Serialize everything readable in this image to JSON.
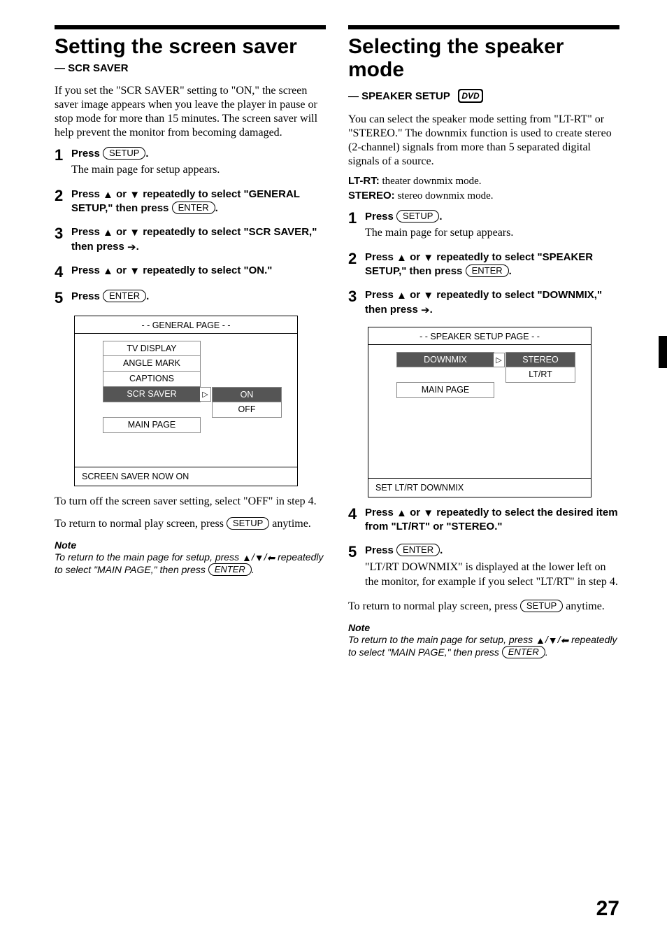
{
  "page_number": "27",
  "left": {
    "title": "Setting the screen saver",
    "subtitle": "— SCR SAVER",
    "intro": "If you set the \"SCR SAVER\" setting to \"ON,\" the screen saver image appears when you leave the player in pause or stop mode for more than 15 minutes. The screen saver will help prevent the monitor from becoming damaged.",
    "steps": {
      "s1a": "Press ",
      "s1btn": "SETUP",
      "s1b": ".",
      "s1sub": "The main page for setup appears.",
      "s2a": "Press ",
      "s2b": " or ",
      "s2c": " repeatedly to select \"GENERAL SETUP,\" then press ",
      "s2btn": "ENTER",
      "s2d": ".",
      "s3a": "Press ",
      "s3b": " or ",
      "s3c": " repeatedly to select \"SCR SAVER,\" then press ",
      "s3d": ".",
      "s4a": "Press ",
      "s4b": " or ",
      "s4c": " repeatedly to select \"ON.\"",
      "s5a": "Press ",
      "s5btn": "ENTER",
      "s5b": "."
    },
    "osd": {
      "title": "- - GENERAL PAGE - -",
      "items": [
        "TV  DISPLAY",
        "ANGLE MARK",
        "CAPTIONS",
        "SCR SAVER",
        "MAIN PAGE"
      ],
      "options": [
        "ON",
        "OFF"
      ],
      "footer": "SCREEN SAVER NOW ON"
    },
    "after1": "To turn off the screen saver setting, select \"OFF\" in step 4.",
    "after2a": "To return to normal play screen, press ",
    "after2btn": "SETUP",
    "after2b": " anytime.",
    "note_h": "Note",
    "note_a": "To return to the main page for setup, press ",
    "note_b": " repeatedly to select \"MAIN PAGE,\" then press ",
    "note_btn": "ENTER",
    "note_c": "."
  },
  "right": {
    "title_a": "Selecting the speaker mode",
    "subtitle": " — SPEAKER SETUP",
    "intro": "You can select the speaker mode setting from \"LT-RT\" or \"STEREO.\" The downmix function is used to create stereo (2-channel) signals from more than 5 separated digital signals of a source.",
    "def1_k": "LT-RT:",
    "def1_v": " theater downmix mode.",
    "def2_k": "STEREO:",
    "def2_v": " stereo downmix mode.",
    "steps": {
      "s1a": "Press ",
      "s1btn": "SETUP",
      "s1b": ".",
      "s1sub": "The main page for setup appears.",
      "s2a": "Press ",
      "s2b": " or ",
      "s2c": " repeatedly to select \"SPEAKER SETUP,\" then press ",
      "s2btn": "ENTER",
      "s2d": ".",
      "s3a": "Press ",
      "s3b": " or ",
      "s3c": " repeatedly to select \"DOWNMIX,\" then press ",
      "s3d": ".",
      "s4a": "Press ",
      "s4b": " or ",
      "s4c": " repeatedly to select the desired item from \"LT/RT\" or \"STEREO.\"",
      "s5a": "Press ",
      "s5btn": "ENTER",
      "s5b": ".",
      "s5sub": "\"LT/RT DOWNMIX\" is displayed at the lower left on the monitor, for example if you select \"LT/RT\" in step 4."
    },
    "osd": {
      "title": "- - SPEAKER SETUP PAGE - -",
      "items": [
        "DOWNMIX",
        "MAIN PAGE"
      ],
      "options": [
        "STEREO",
        "LT/RT"
      ],
      "footer": "SET LT/RT DOWNMIX"
    },
    "after2a": "To return to normal play screen, press ",
    "after2btn": "SETUP",
    "after2b": " anytime.",
    "note_h": "Note",
    "note_a": "To return to the main page for setup, press ",
    "note_b": " repeatedly to select \"MAIN PAGE,\" then press ",
    "note_btn": "ENTER",
    "note_c": "."
  }
}
